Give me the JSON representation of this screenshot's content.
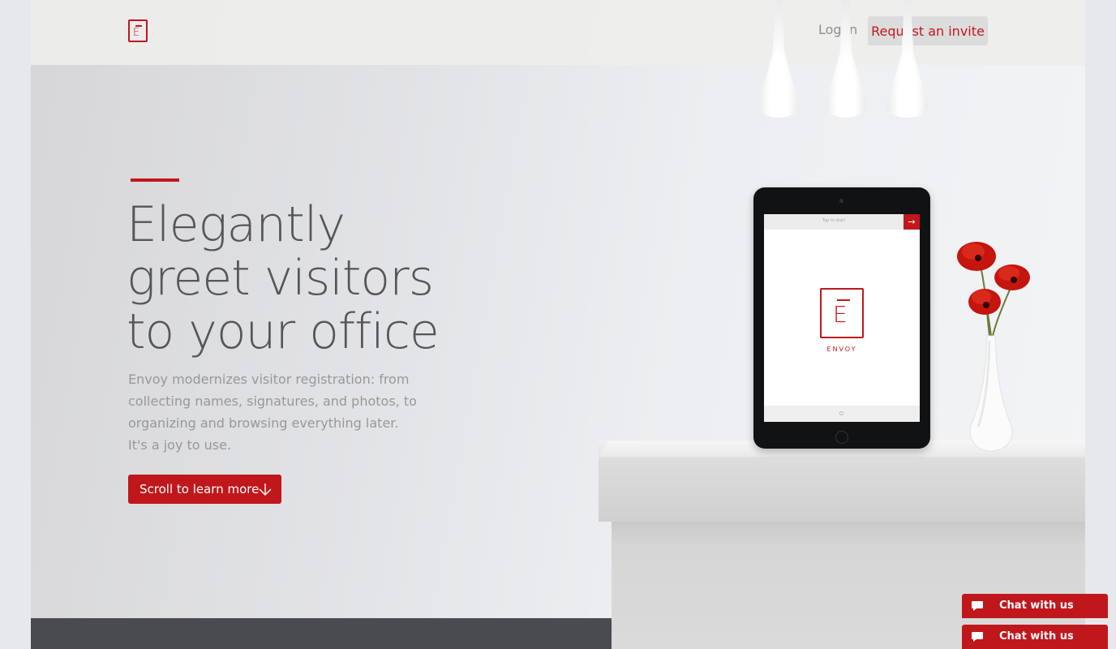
{
  "header": {
    "logo_letter": "E",
    "login_label": "Log in",
    "invite_label": "Request an invite"
  },
  "hero": {
    "headline_lines": [
      "Elegantly",
      "greet visitors",
      "to your office"
    ],
    "intro_lines": [
      "Envoy modernizes visitor registration: from",
      "collecting names, signatures, and photos, to",
      "organizing and browsing everything later.",
      "It's a joy to use."
    ],
    "cta_label": "Scroll to learn more"
  },
  "device": {
    "tap_text": "Tap to start",
    "logo_letter": "E",
    "brand_name": "ENVOY"
  },
  "chat_widgets": [
    {
      "label": "Chat with us"
    },
    {
      "label": "Chat with us"
    }
  ],
  "colors": {
    "accent": "#c0171c",
    "dark_band": "#4a4b50",
    "heading": "#555658",
    "body_text": "#97989a"
  }
}
